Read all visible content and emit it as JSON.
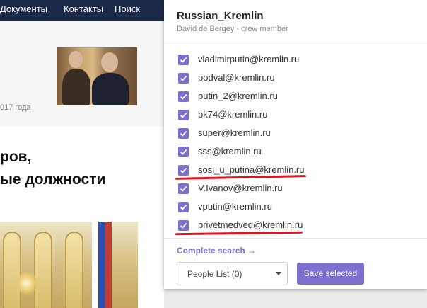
{
  "nav": {
    "items": [
      "Документы",
      "Контакты",
      "Поиск"
    ]
  },
  "background": {
    "date_fragment": "017 года",
    "headline_line1": "ров,",
    "headline_line2": "ые должности"
  },
  "popup": {
    "title": "Russian_Kremlin",
    "subtitle": "David de Bergey - crew member",
    "emails": [
      {
        "address": "vladimirputin@kremlin.ru",
        "checked": true,
        "underlined": false
      },
      {
        "address": "podval@kremlin.ru",
        "checked": true,
        "underlined": false
      },
      {
        "address": "putin_2@kremlin.ru",
        "checked": true,
        "underlined": false
      },
      {
        "address": "bk74@kremlin.ru",
        "checked": true,
        "underlined": false
      },
      {
        "address": "super@kremlin.ru",
        "checked": true,
        "underlined": false
      },
      {
        "address": "sss@kremlin.ru",
        "checked": true,
        "underlined": false
      },
      {
        "address": "sosi_u_putina@kremlin.ru",
        "checked": true,
        "underlined": true
      },
      {
        "address": "V.Ivanov@kremlin.ru",
        "checked": true,
        "underlined": false
      },
      {
        "address": "vputin@kremlin.ru",
        "checked": true,
        "underlined": false
      },
      {
        "address": "privetmedved@kremlin.ru",
        "checked": true,
        "underlined": true
      }
    ],
    "complete_search_label": "Complete search →",
    "list_select_value": "People List (0)",
    "save_label": "Save selected"
  },
  "colors": {
    "accent": "#7b6fd0",
    "nav_bg": "#1c2a4a",
    "annotation_red": "#e0141e"
  }
}
